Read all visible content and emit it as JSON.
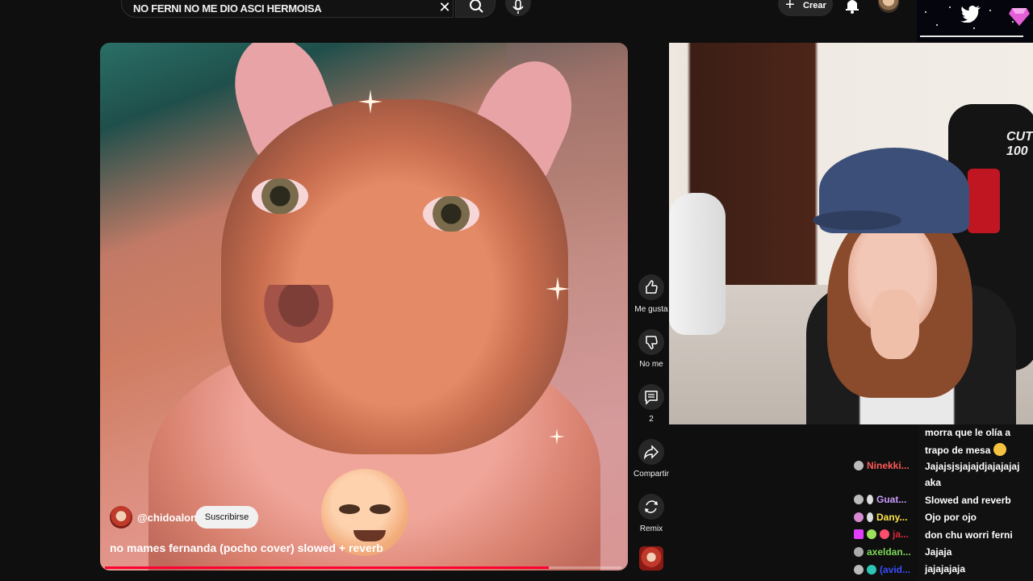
{
  "topbar": {
    "search_query": "NO FERNI NO ME DIO ASCI HERMOISA",
    "create_label": "Crear"
  },
  "video": {
    "channel_handle": "@chidoalon",
    "subscribe_label": "Suscribirse",
    "title": "no mames fernanda (pocho cover) slowed + reverb",
    "progress_percent": 86
  },
  "actions": {
    "like_label": "Me gusta",
    "dislike_label": "No me",
    "comments_count": "2",
    "share_label": "Compartir",
    "remix_label": "Remix"
  },
  "webcam": {
    "chair_brand": "CUTT\n100"
  },
  "chat_usernames": [
    {
      "name": "Ninekki...",
      "color": "#ff5a5a"
    },
    {
      "name": "Guat...",
      "color": "#c99cff"
    },
    {
      "name": "Dany...",
      "color": "#ffe44a"
    },
    {
      "name": "ja...",
      "color": "#e0283a"
    },
    {
      "name": "axeldan...",
      "color": "#7ed957"
    },
    {
      "name": "(avid...",
      "color": "#3a4cff"
    }
  ],
  "chat_messages": [
    "morra que le olía a",
    "trapo de mesa",
    "Jajajsjsjajajdjajajajaj",
    "aka",
    "Slowed and reverb",
    "Ojo por ojo",
    "don chu worri ferni",
    "Jajaja",
    "jajajajaja"
  ],
  "colors": {
    "background": "#0f0f0f",
    "progress": "#ff0033",
    "subscribe_bg": "#f1f1f1"
  }
}
